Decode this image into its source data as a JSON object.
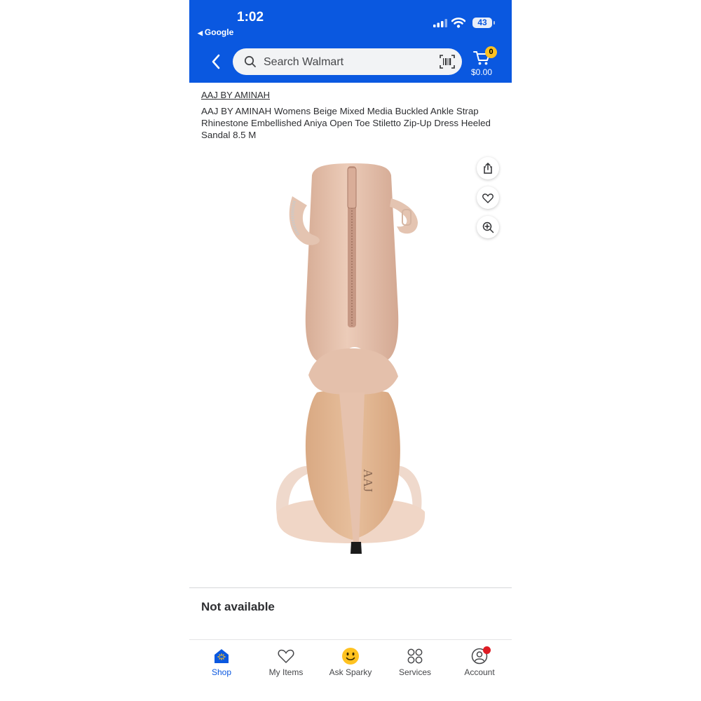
{
  "status_bar": {
    "time": "1:02",
    "back_app": "Google",
    "battery": "43"
  },
  "header": {
    "search_placeholder": "Search Walmart",
    "cart_count": "0",
    "cart_total": "$0.00"
  },
  "product": {
    "brand": "AAJ BY AMINAH",
    "title": "AAJ BY AMINAH Womens Beige Mixed Media Buckled Ankle Strap Rhinestone Embellished Aniya Open Toe Stiletto Zip-Up Dress Heeled Sandal 8.5 M",
    "sole_logo": "AAJ",
    "availability": "Not available"
  },
  "image_actions": [
    {
      "icon": "share-icon"
    },
    {
      "icon": "heart-icon"
    },
    {
      "icon": "zoom-in-icon"
    }
  ],
  "bottom_nav": [
    {
      "label": "Shop",
      "icon": "shop-icon",
      "active": true
    },
    {
      "label": "My Items",
      "icon": "heart-icon"
    },
    {
      "label": "Ask Sparky",
      "icon": "sparky-icon"
    },
    {
      "label": "Services",
      "icon": "services-icon"
    },
    {
      "label": "Account",
      "icon": "account-icon",
      "notification": true
    }
  ],
  "colors": {
    "brand_blue": "#0a58e0",
    "spark_yellow": "#ffc220",
    "alert_red": "#de1c24",
    "shoe_beige": "#e9c6b2"
  }
}
